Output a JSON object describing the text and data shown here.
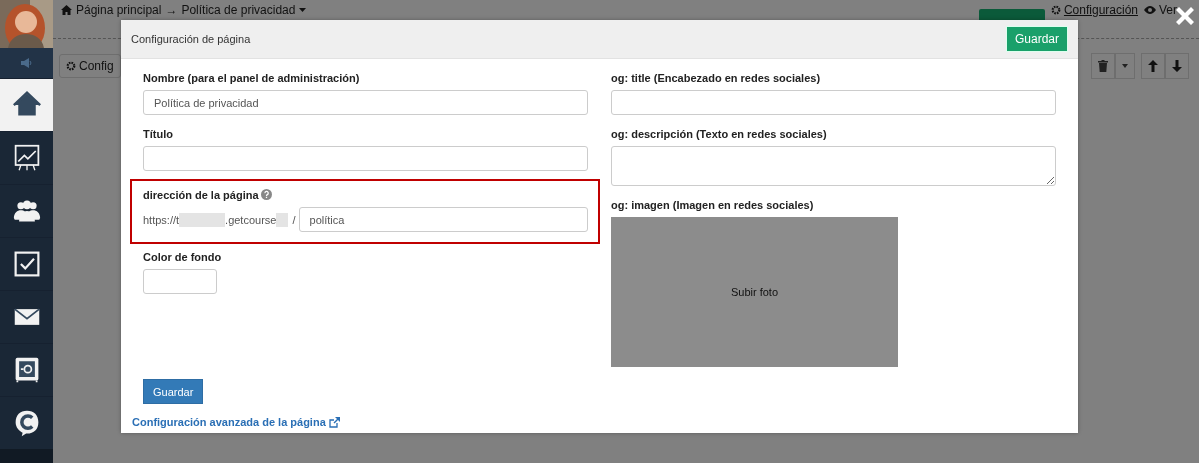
{
  "sidebar": {
    "items": [
      {
        "kind": "home",
        "selected": true
      },
      {
        "kind": "chart",
        "selected": false
      },
      {
        "kind": "people",
        "selected": false
      },
      {
        "kind": "tasks",
        "selected": false
      },
      {
        "kind": "mail",
        "selected": false
      },
      {
        "kind": "safe",
        "selected": false
      },
      {
        "kind": "chat",
        "selected": false
      }
    ]
  },
  "background_page": {
    "breadcrumb": [
      "Página principal",
      "→",
      "Política de privacidad"
    ],
    "settings_link": "Configuración",
    "view_link": "Ver",
    "toolbar_button": "Config"
  },
  "modal": {
    "title": "Configuración de página",
    "header_button": "Guardar",
    "left_fields": [
      {
        "kind": "input",
        "label": "Nombre (para el panel de administración)",
        "value": "Política de privacidad"
      },
      {
        "kind": "input",
        "label": "Título"
      },
      {
        "kind": "url",
        "label": "dirección de la página",
        "highlighted": true,
        "prefix": "https://t",
        "domain": ".getcourse",
        "separator": "/",
        "value": "política"
      },
      {
        "kind": "color",
        "label": "Color de fondo"
      }
    ],
    "right_fields": [
      {
        "kind": "input",
        "label": "og: title (Encabezado en redes sociales)"
      },
      {
        "kind": "textarea",
        "label": "og: descripción (Texto en redes sociales)"
      },
      {
        "label": "og: imagen (Imagen en redes sociales)",
        "button": "Subir foto"
      }
    ],
    "save_button": "Guardar",
    "advanced_link": "Configuración avanzada de la página"
  }
}
